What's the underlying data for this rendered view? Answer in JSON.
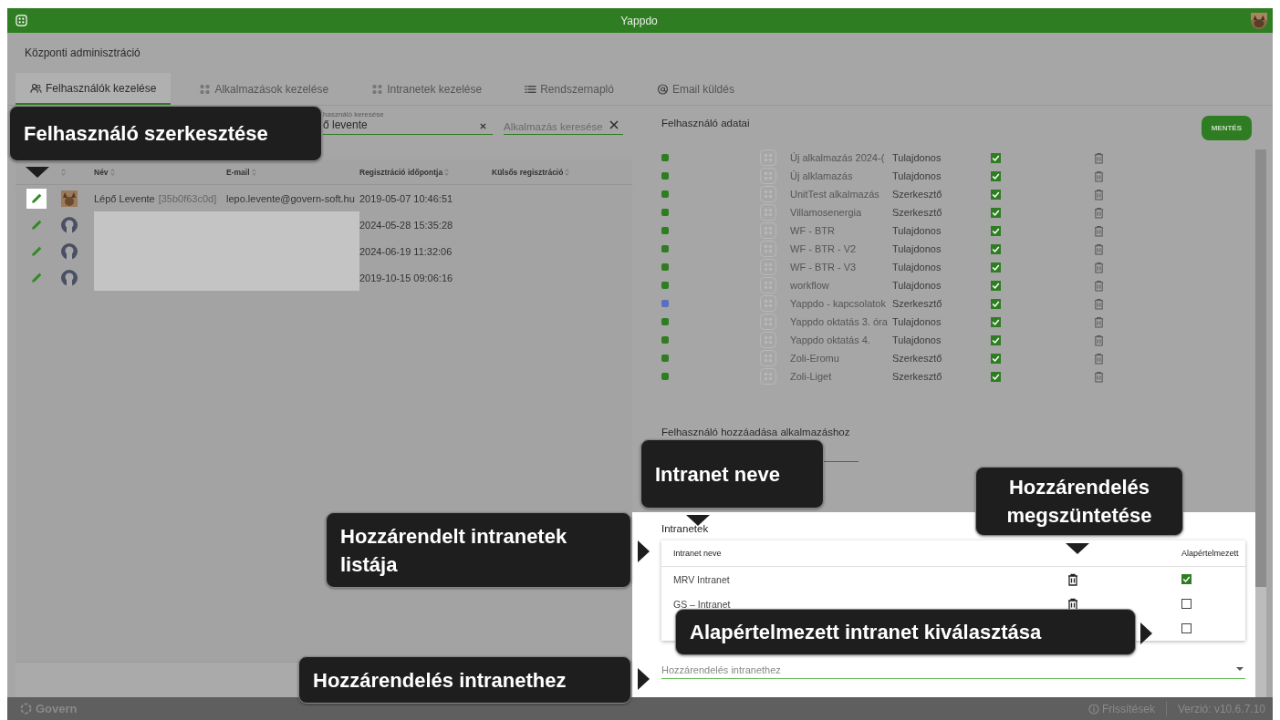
{
  "header": {
    "title": "Yappdo"
  },
  "page_title": "Központi adminisztráció",
  "tabs": [
    {
      "label": "Felhasználók kezelése",
      "kind": "users",
      "selected": true
    },
    {
      "label": "Alkalmazások kezelése",
      "kind": "grid",
      "selected": false
    },
    {
      "label": "Intranetek kezelése",
      "kind": "grid",
      "selected": false
    },
    {
      "label": "Rendszernapló",
      "kind": "list",
      "selected": false
    },
    {
      "label": "Email küldés",
      "kind": "at",
      "selected": false
    }
  ],
  "user_search": {
    "label": "használó keresése",
    "value": "ő levente"
  },
  "app_search": {
    "placeholder": "Alkalmazás keresése"
  },
  "users_table": {
    "columns": [
      "Név",
      "E-mail",
      "Regisztráció időpontja",
      "Külsős regisztráció"
    ],
    "rows": [
      {
        "name": "Lépő Levente",
        "id": "[35b0f63c0d]",
        "email": "lepo.levente@govern-soft.hu",
        "registered": "2019-05-07 10:46:51",
        "highlighted": true,
        "redacted": false
      },
      {
        "kind": "silhouette",
        "registered": "2024-05-28 15:35:28",
        "highlighted": false,
        "redacted": true
      },
      {
        "kind": "silhouette",
        "registered": "2024-06-19 11:32:06",
        "highlighted": false,
        "redacted": true
      },
      {
        "kind": "silhouette",
        "registered": "2019-10-15 09:06:16",
        "highlighted": false,
        "redacted": true
      }
    ]
  },
  "user_details": {
    "title": "Felhasználó adatai",
    "save_button": "MENTÉS",
    "add_label": "Felhasználó hozzáadása alkalmazáshoz",
    "apps": [
      {
        "color": "#2e7d21",
        "name": "Új alkalmazás 2024-(",
        "role": "Tulajdonos",
        "checked": true
      },
      {
        "color": "#2e7d21",
        "name": "Új alklamazás",
        "role": "Tulajdonos",
        "checked": true
      },
      {
        "color": "#2e7d21",
        "name": "UnitTest alkalmazás",
        "role": "Szerkesztő",
        "checked": true
      },
      {
        "color": "#2e7d21",
        "name": "Villamosenergia",
        "role": "Szerkesztő",
        "checked": true
      },
      {
        "color": "#2e7d21",
        "name": "WF - BTR",
        "role": "Tulajdonos",
        "checked": true
      },
      {
        "color": "#2e7d21",
        "name": "WF - BTR - V2",
        "role": "Tulajdonos",
        "checked": true
      },
      {
        "color": "#2e7d21",
        "name": "WF - BTR - V3",
        "role": "Tulajdonos",
        "checked": true
      },
      {
        "color": "#2e7d21",
        "name": "workflow",
        "role": "Tulajdonos",
        "checked": true
      },
      {
        "color": "#5a6fc0",
        "name": "Yappdo - kapcsolatok",
        "role": "Szerkesztő",
        "checked": true
      },
      {
        "color": "#2e7d21",
        "name": "Yappdo oktatás 3. óra",
        "role": "Tulajdonos",
        "checked": true
      },
      {
        "color": "#2e7d21",
        "name": "Yappdo oktatás 4.",
        "role": "Tulajdonos",
        "checked": true
      },
      {
        "color": "#2e7d21",
        "name": "Zoli-Eromu",
        "role": "Szerkesztő",
        "checked": true
      },
      {
        "color": "#2e7d21",
        "name": "Zoli-Liget",
        "role": "Szerkesztő",
        "checked": true
      }
    ]
  },
  "intranets": {
    "title": "Intranetek",
    "columns": [
      "Intranet neve",
      "Alapértelmezett"
    ],
    "rows": [
      {
        "name": "MRV Intranet",
        "default": true
      },
      {
        "name": "GS – Intranet",
        "default": false
      },
      {
        "default": false
      }
    ],
    "assign_placeholder": "Hozzárendelés intranethez"
  },
  "footer": {
    "brand": "Govern",
    "updates": "Frissítések",
    "version": "Verzió: v10.6.7.10"
  },
  "callouts": [
    "Felhasználó szerkesztése",
    "Intranet neve",
    "Hozzárendelés megszüntetése",
    "Hozzárendelt intranetek listája",
    "Alapértelmezett intranet kiválasztása",
    "Hozzárendelés intranethez"
  ]
}
